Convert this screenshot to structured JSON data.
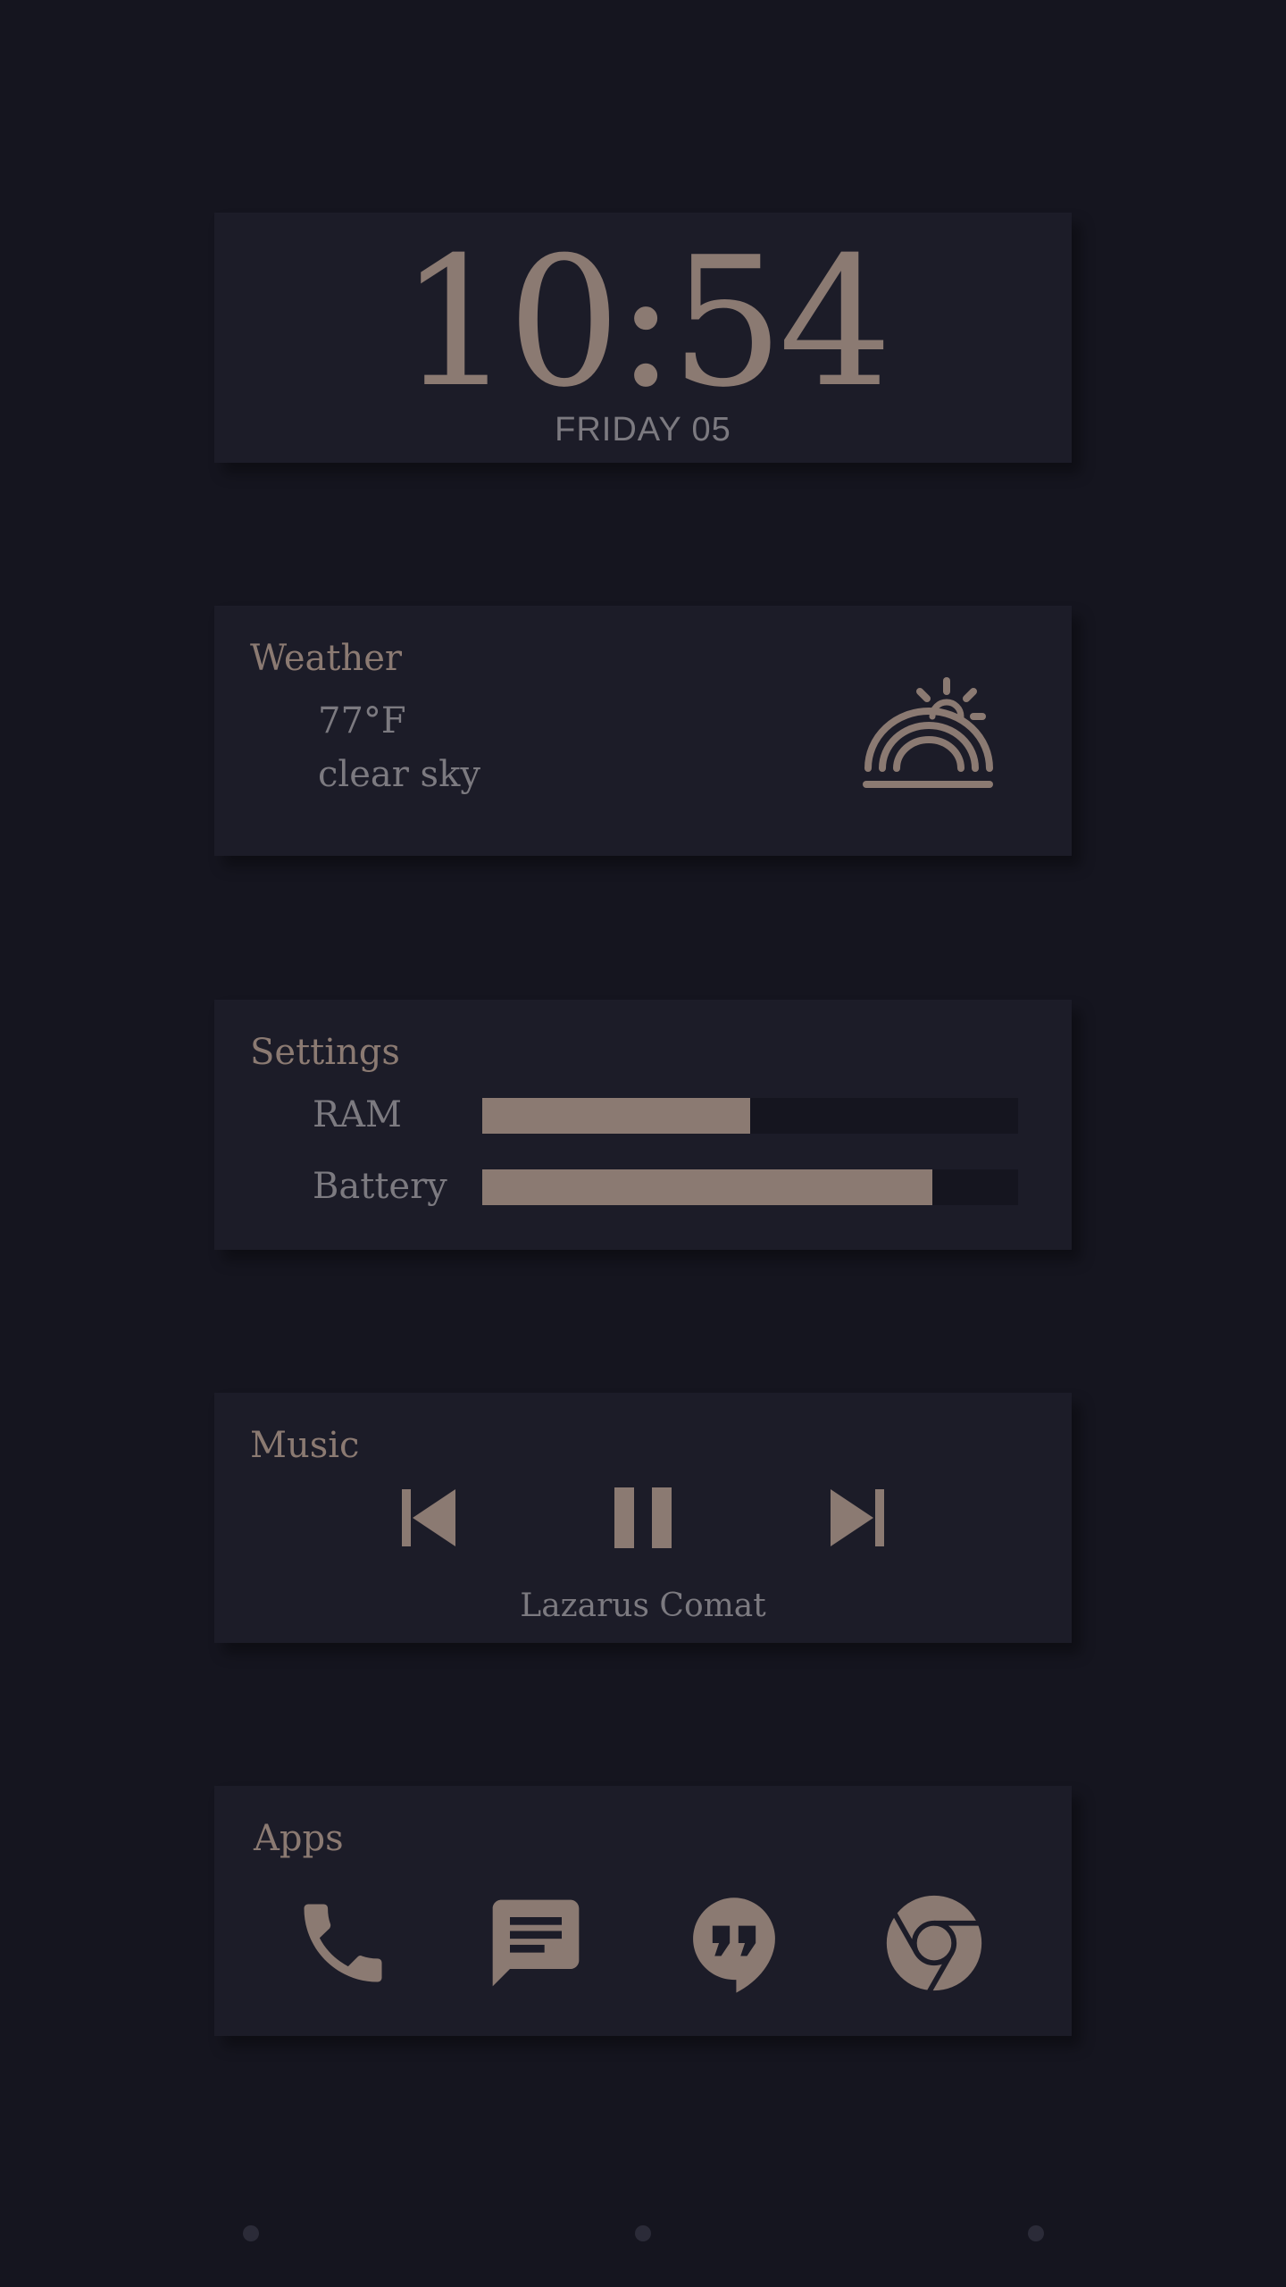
{
  "clock": {
    "time": "10:54",
    "date": "FRIDAY 05"
  },
  "weather": {
    "title": "Weather",
    "temperature": "77°F",
    "condition": "clear sky",
    "icon": "sunrise-icon"
  },
  "settings": {
    "title": "Settings",
    "items": [
      {
        "label": "RAM",
        "level": 0.5
      },
      {
        "label": "Battery",
        "level": 0.84
      }
    ]
  },
  "music": {
    "title": "Music",
    "track": "Lazarus Comat",
    "controls": [
      "skip-previous-icon",
      "pause-icon",
      "skip-next-icon"
    ]
  },
  "apps": {
    "title": "Apps",
    "items": [
      "phone-icon",
      "message-icon",
      "hangouts-icon",
      "chrome-icon"
    ]
  },
  "colors": {
    "background": "#15151f",
    "card": "#1c1c28",
    "accent": "#8b7a72",
    "text": "#7c7a80"
  },
  "pager": {
    "pages": 3
  }
}
